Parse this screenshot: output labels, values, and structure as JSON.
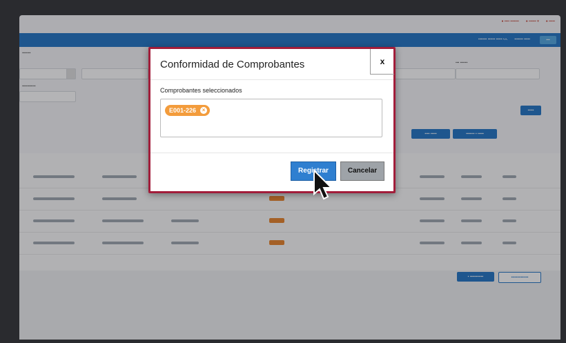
{
  "modal": {
    "title": "Conformidad de Comprobantes",
    "close_label": "x",
    "field_label": "Comprobantes seleccionados",
    "selected_chip": "E001-226",
    "register_label": "Registrar",
    "cancel_label": "Cancelar"
  },
  "colors": {
    "primary_bar": "#1a6fc2",
    "modal_border": "#a21d3a",
    "chip": "#f39c3c",
    "register_button": "#2f7fd0",
    "cancel_button": "#9ea3a8"
  },
  "icons": [
    "close-icon",
    "remove-chip-icon",
    "mouse-pointer-icon"
  ]
}
